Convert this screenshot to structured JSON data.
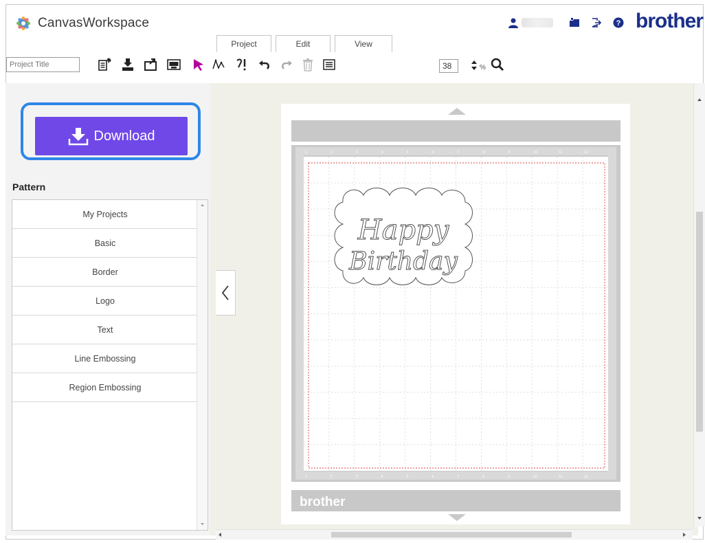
{
  "app": {
    "name": "CanvasWorkspace",
    "brand": "brother",
    "accent_color": "#7048e8",
    "highlight_color": "#2f86e8"
  },
  "header": {
    "tabs": [
      {
        "label": "Project"
      },
      {
        "label": "Edit"
      },
      {
        "label": "View"
      }
    ],
    "icons": [
      "user-icon",
      "folder-icon",
      "logout-icon",
      "help-icon"
    ]
  },
  "toolbar": {
    "project_title_placeholder": "Project Title",
    "zoom_value": "38",
    "zoom_unit": "%",
    "icons": [
      "new-project-icon",
      "save-icon",
      "open-project-icon",
      "import-svg-icon",
      "select-arrow-icon",
      "edit-points-icon",
      "object-edit-icon",
      "undo-icon",
      "redo-icon",
      "delete-icon",
      "properties-icon",
      "zoom-icon"
    ]
  },
  "sidebar": {
    "download_label": "Download",
    "pattern_heading": "Pattern",
    "categories": [
      {
        "label": "My Projects"
      },
      {
        "label": "Basic"
      },
      {
        "label": "Border"
      },
      {
        "label": "Logo"
      },
      {
        "label": "Text"
      },
      {
        "label": "Line Embossing"
      },
      {
        "label": "Region Embossing"
      }
    ]
  },
  "canvas": {
    "design_line1": "Happy",
    "design_line2": "Birthday",
    "mat_brand": "brother",
    "ruler_top": [
      "1",
      "2",
      "3",
      "4",
      "5",
      "6",
      "7",
      "8",
      "9",
      "10",
      "11",
      "12"
    ],
    "ruler_bottom": [
      "1",
      "2",
      "3",
      "4",
      "5",
      "6",
      "7",
      "8",
      "9",
      "10",
      "11",
      "12"
    ]
  }
}
